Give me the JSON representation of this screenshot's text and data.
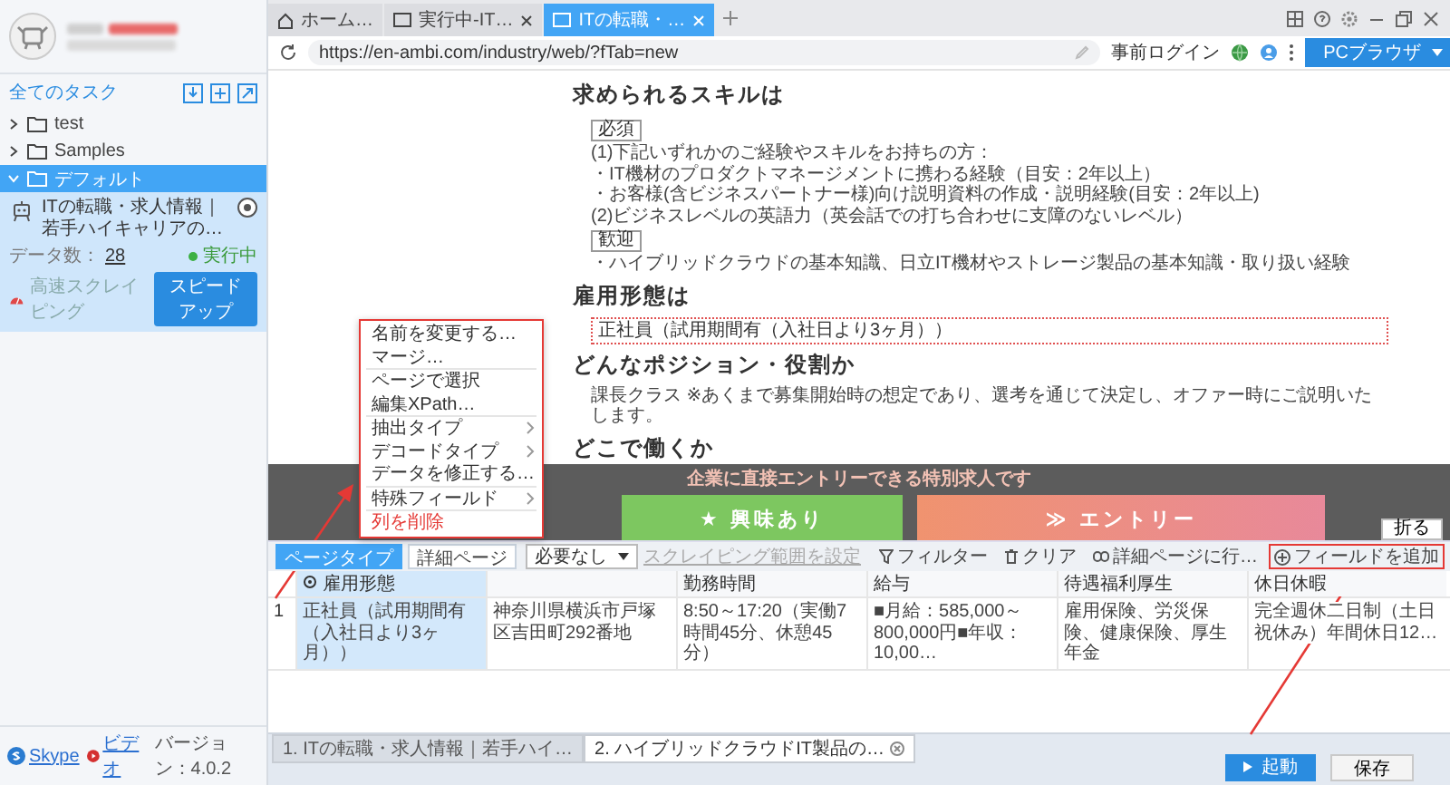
{
  "sidebar": {
    "section_title": "全てのタスク",
    "folders": [
      {
        "label": "test",
        "expanded": false,
        "selected": false
      },
      {
        "label": "Samples",
        "expanded": false,
        "selected": false
      },
      {
        "label": "デフォルト",
        "expanded": true,
        "selected": true
      }
    ],
    "task": {
      "title": "ITの転職・求人情報｜若手ハイキャリアの…",
      "data_count_label": "データ数：",
      "data_count": "28",
      "status": "実行中",
      "mode": "高速スクレイピング",
      "speed_button": "スピードアップ"
    },
    "footer_links": [
      {
        "label": "Skype",
        "kind": "skype"
      },
      {
        "label": "ビデオ",
        "kind": "video"
      }
    ],
    "version": "バージョン：4.0.2"
  },
  "browser": {
    "tabs": [
      {
        "label": "ホーム…",
        "kind": "home",
        "closable": false,
        "selected": false
      },
      {
        "label": "実行中-IT…",
        "kind": "page",
        "closable": true,
        "selected": false
      },
      {
        "label": "ITの転職・…",
        "kind": "page",
        "closable": true,
        "selected": true
      }
    ],
    "url": "https://en-ambi.com/industry/web/?fTab=new",
    "login_button": "事前ログイン",
    "mode_button": "PCブラウザ"
  },
  "page": {
    "sections": [
      {
        "heading": "求められるスキルは",
        "blocks": [
          {
            "kind": "badge",
            "text": "必須"
          },
          {
            "kind": "text",
            "text": "(1)下記いずれかのご経験やスキルをお持ちの方："
          },
          {
            "kind": "text",
            "text": "・IT機材のプロダクトマネージメントに携わる経験（目安：2年以上）"
          },
          {
            "kind": "text",
            "text": "・お客様(含ビジネスパートナー様)向け説明資料の作成・説明経験(目安：2年以上)"
          },
          {
            "kind": "text",
            "text": "(2)ビジネスレベルの英語力（英会話での打ち合わせに支障のないレベル）"
          },
          {
            "kind": "badge",
            "text": "歓迎"
          },
          {
            "kind": "text",
            "text": "・ハイブリッドクラウドの基本知識、日立IT機材やストレージ製品の基本知識・取り扱い経験"
          }
        ]
      },
      {
        "heading": "雇用形態は",
        "blocks": [
          {
            "kind": "highlight",
            "text": "正社員（試用期間有（入社日より3ヶ月））"
          }
        ]
      },
      {
        "heading": "どんなポジション・役割か",
        "blocks": [
          {
            "kind": "text",
            "text": "課長クラス ※あくまで募集開始時の想定であり、選考を通じて決定し、オファー時にご説明いたします。"
          }
        ]
      },
      {
        "heading": "どこで働くか"
      }
    ]
  },
  "banner": {
    "text": "企業に直接エントリーできる特別求人です",
    "buttons": [
      {
        "label": "★ 興味あり",
        "kind": "interest"
      },
      {
        "label": "≫ エントリー",
        "kind": "entry"
      }
    ]
  },
  "collapse_button": "折る",
  "data_panel": {
    "tabs": [
      {
        "label": "ページタイプ",
        "selected": true
      },
      {
        "label": "詳細ページ",
        "selected": false
      }
    ],
    "dropdown": "必要なし",
    "range_link": {
      "label": "スクレイピング範囲を設定",
      "disabled": true
    },
    "actions": [
      {
        "label": "フィルター",
        "kind": "filter",
        "highlighted": false
      },
      {
        "label": "クリア",
        "kind": "clear",
        "highlighted": false
      },
      {
        "label": "詳細ページに行…",
        "kind": "link",
        "highlighted": false
      },
      {
        "label": "フィールドを追加",
        "kind": "add",
        "highlighted": true
      }
    ],
    "columns": [
      {
        "label": "雇用形態",
        "selected": true
      },
      {
        "selected": false
      },
      {
        "label": "勤務時間",
        "selected": false
      },
      {
        "label": "給与",
        "selected": false
      },
      {
        "label": "待遇福利厚生",
        "selected": false
      },
      {
        "label": "休日休暇",
        "selected": false
      }
    ],
    "rows": [
      {
        "index": "1",
        "cells": [
          "正社員（試用期間有（入社日より3ヶ月））",
          "神奈川県横浜市戸塚区吉田町292番地",
          "8:50～17:20（実働7時間45分、休憩45分）",
          "■月給：585,000～800,000円■年収：10,00…",
          "雇用保険、労災保険、健康保険、厚生年金",
          "完全週休二日制（土日祝休み）年間休日12…"
        ]
      }
    ]
  },
  "context_menu": {
    "groups": [
      [
        {
          "label": "名前を変更する…",
          "kind": "action"
        },
        {
          "label": "マージ…",
          "kind": "action"
        }
      ],
      [
        {
          "label": "ページで選択",
          "kind": "action"
        },
        {
          "label": "編集XPath…",
          "kind": "action"
        }
      ],
      [
        {
          "label": "抽出タイプ",
          "kind": "submenu"
        },
        {
          "label": "デコードタイプ",
          "kind": "submenu"
        },
        {
          "label": "データを修正する…",
          "kind": "action"
        }
      ],
      [
        {
          "label": "特殊フィールド",
          "kind": "submenu"
        }
      ],
      [
        {
          "label": "列を削除",
          "kind": "danger"
        }
      ]
    ]
  },
  "task_tabs": [
    {
      "label": "1. ITの転職・求人情報｜若手ハイ…",
      "closable": false,
      "selected": false
    },
    {
      "label": "2. ハイブリッドクラウドIT製品の…",
      "closable": true,
      "selected": true
    }
  ],
  "buttons": {
    "start": "起動",
    "save": "保存"
  }
}
